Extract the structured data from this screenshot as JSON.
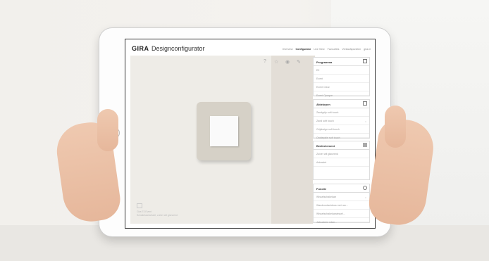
{
  "app": {
    "logo": "GIRA",
    "title": "Designconfigurator"
  },
  "nav": [
    {
      "label": "Overview",
      "active": false
    },
    {
      "label": "Configurator",
      "active": true
    },
    {
      "label": "Live View",
      "active": false
    },
    {
      "label": "Favourites",
      "active": false
    },
    {
      "label": "Verkaufspunkten",
      "active": false
    },
    {
      "label": "gira.nl",
      "active": false
    }
  ],
  "toolbar": {
    "help_icon": "?",
    "star_icon": "☆",
    "eye_icon": "◉",
    "pencil_icon": "✎"
  },
  "panel": {
    "programs": {
      "title": "Programma",
      "items": [
        "E2",
        "Event",
        "Event Clear",
        "Event Opaque"
      ]
    },
    "finishes": {
      "title": "Afdekrpen",
      "items": [
        "Zandgrijs soft touch",
        "Zand soft touch",
        "Grijsbeige soft touch",
        "Ondiepzlie soft touch"
      ]
    },
    "inserts": {
      "title": "Bedieelement",
      "items": [
        "Zuiver wit glanzend",
        "Antraciet"
      ]
    },
    "functions": {
      "title": "Functie",
      "items": [
        "Wisselschakelaar",
        "Wandcontactdoos met ran...",
        "Wisselschakelaarwissel...",
        "Jalouzieen rolan..."
      ]
    }
  },
  "stage_caption": {
    "line1": "Gira E3 Event",
    "line2": "Schakelaar/wissel, zuiver wit glanzend"
  }
}
